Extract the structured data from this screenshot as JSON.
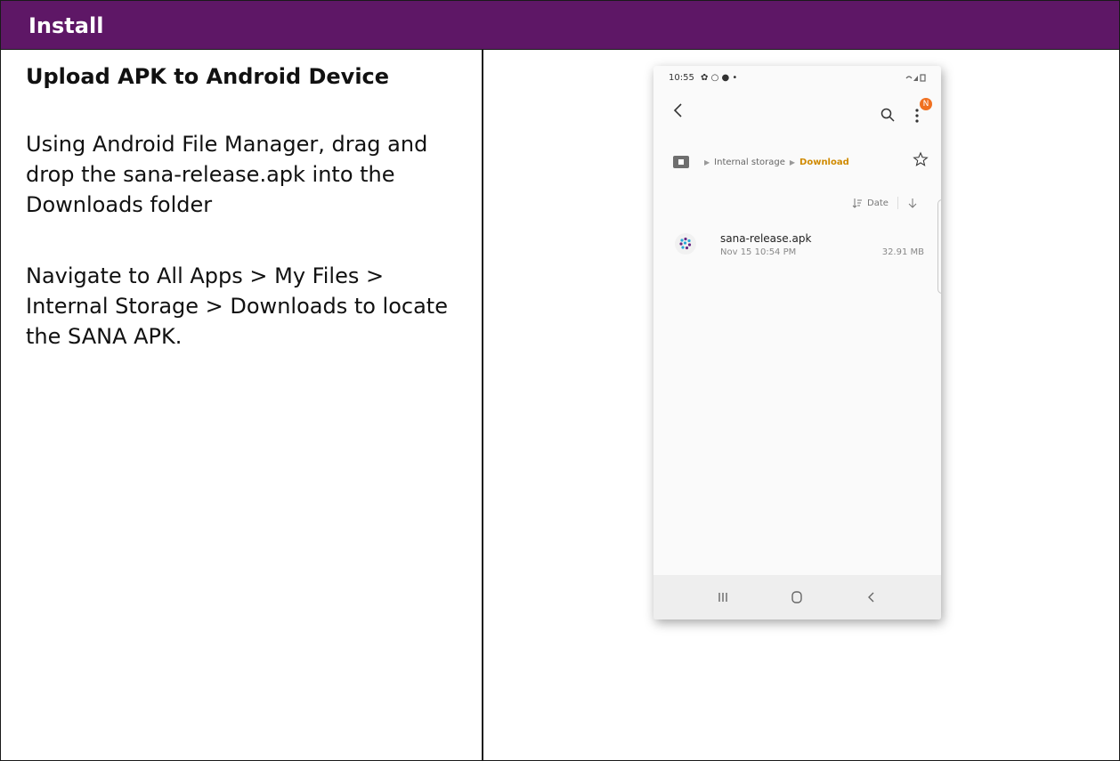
{
  "header": {
    "title": "Install"
  },
  "step": {
    "title": "Upload APK to Android Device",
    "paragraph1": "Using Android File Manager, drag and drop the sana-release.apk into the Downloads folder",
    "paragraph2": "Navigate to All Apps > My Files > Internal Storage > Downloads to locate the SANA APK."
  },
  "phone": {
    "status_time": "10:55",
    "status_icons": "✿ ○ ● •",
    "badge": "N",
    "breadcrumb": [
      "Internal storage",
      "Download"
    ],
    "sort_label": "Date",
    "file": {
      "name": "sana-release.apk",
      "date": "Nov 15 10:54 PM",
      "size": "32.91 MB"
    }
  },
  "colors": {
    "header_bg": "#5e1766",
    "breadcrumb_active": "#d08a00",
    "badge": "#f07020"
  },
  "icons": [
    "back-arrow-icon",
    "search-icon",
    "more-vert-icon",
    "home-icon",
    "star-icon",
    "sort-icon",
    "arrow-down-icon",
    "apk-file-icon",
    "recents-icon",
    "home-nav-icon",
    "back-nav-icon"
  ]
}
